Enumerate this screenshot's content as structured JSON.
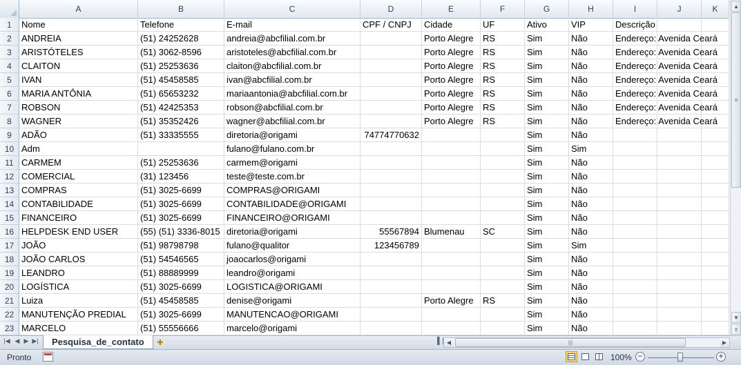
{
  "columns": [
    "A",
    "B",
    "C",
    "D",
    "E",
    "F",
    "G",
    "H",
    "I",
    "J",
    "K"
  ],
  "rows": [
    {
      "n": "1",
      "cells": [
        "Nome",
        "Telefone",
        "E-mail",
        "CPF / CNPJ",
        "Cidade",
        "UF",
        "Ativo",
        "VIP",
        "Descrição",
        "",
        ""
      ]
    },
    {
      "n": "2",
      "cells": [
        "ANDREIA",
        "(51) 24252628",
        "andreia@abcfilial.com.br",
        "",
        "Porto Alegre",
        "RS",
        "Sim",
        "Não",
        "Endereço: Avenida Ceará",
        "",
        ""
      ]
    },
    {
      "n": "3",
      "cells": [
        "ARISTÓTELES",
        "(51) 3062-8596",
        "aristoteles@abcfilial.com.br",
        "",
        "Porto Alegre",
        "RS",
        "Sim",
        "Não",
        "Endereço: Avenida Ceará",
        "",
        ""
      ]
    },
    {
      "n": "4",
      "cells": [
        "CLAITON",
        "(51) 25253636",
        "claiton@abcfilial.com.br",
        "",
        "Porto Alegre",
        "RS",
        "Sim",
        "Não",
        "Endereço: Avenida Ceará",
        "",
        ""
      ]
    },
    {
      "n": "5",
      "cells": [
        "IVAN",
        "(51) 45458585",
        "ivan@abcfilial.com.br",
        "",
        "Porto Alegre",
        "RS",
        "Sim",
        "Não",
        "Endereço: Avenida Ceará",
        "",
        ""
      ]
    },
    {
      "n": "6",
      "cells": [
        "MARIA ANTÔNIA",
        "(51) 65653232",
        "mariaantonia@abcfilial.com.br",
        "",
        "Porto Alegre",
        "RS",
        "Sim",
        "Não",
        "Endereço: Avenida Ceará",
        "",
        ""
      ]
    },
    {
      "n": "7",
      "cells": [
        "ROBSON",
        "(51) 42425353",
        "robson@abcfilial.com.br",
        "",
        "Porto Alegre",
        "RS",
        "Sim",
        "Não",
        "Endereço: Avenida Ceará",
        "",
        ""
      ]
    },
    {
      "n": "8",
      "cells": [
        "WAGNER",
        "(51) 35352426",
        "wagner@abcfilial.com.br",
        "",
        "Porto Alegre",
        "RS",
        "Sim",
        "Não",
        "Endereço: Avenida Ceará",
        "",
        ""
      ]
    },
    {
      "n": "9",
      "cells": [
        "ADÃO",
        "(51) 33335555",
        "diretoria@origami",
        "74774770632",
        "",
        "",
        "Sim",
        "Não",
        "",
        "",
        ""
      ]
    },
    {
      "n": "10",
      "cells": [
        "Adm",
        "",
        "fulano@fulano.com.br",
        "",
        "",
        "",
        "Sim",
        "Sim",
        "",
        "",
        ""
      ]
    },
    {
      "n": "11",
      "cells": [
        "CARMEM",
        "(51) 25253636",
        "carmem@origami",
        "",
        "",
        "",
        "Sim",
        "Não",
        "",
        "",
        ""
      ]
    },
    {
      "n": "12",
      "cells": [
        "COMERCIAL",
        "(31) 123456",
        "teste@teste.com.br",
        "",
        "",
        "",
        "Sim",
        "Não",
        "",
        "",
        ""
      ]
    },
    {
      "n": "13",
      "cells": [
        "COMPRAS",
        "(51) 3025-6699",
        "COMPRAS@ORIGAMI",
        "",
        "",
        "",
        "Sim",
        "Não",
        "",
        "",
        ""
      ]
    },
    {
      "n": "14",
      "cells": [
        "CONTABILIDADE",
        "(51) 3025-6699",
        "CONTABILIDADE@ORIGAMI",
        "",
        "",
        "",
        "Sim",
        "Não",
        "",
        "",
        ""
      ]
    },
    {
      "n": "15",
      "cells": [
        "FINANCEIRO",
        "(51) 3025-6699",
        "FINANCEIRO@ORIGAMI",
        "",
        "",
        "",
        "Sim",
        "Não",
        "",
        "",
        ""
      ]
    },
    {
      "n": "16",
      "cells": [
        "HELPDESK END USER",
        "(55) (51) 3336-8015",
        "diretoria@origami",
        "55567894",
        "Blumenau",
        "SC",
        "Sim",
        "Não",
        "",
        "",
        ""
      ]
    },
    {
      "n": "17",
      "cells": [
        "JOÃO",
        "(51) 98798798",
        "fulano@qualitor",
        "123456789",
        "",
        "",
        "Sim",
        "Sim",
        "",
        "",
        ""
      ]
    },
    {
      "n": "18",
      "cells": [
        "JOÃO CARLOS",
        "(51) 54546565",
        "joaocarlos@origami",
        "",
        "",
        "",
        "Sim",
        "Não",
        "",
        "",
        ""
      ]
    },
    {
      "n": "19",
      "cells": [
        "LEANDRO",
        "(51) 88889999",
        "leandro@origami",
        "",
        "",
        "",
        "Sim",
        "Não",
        "",
        "",
        ""
      ]
    },
    {
      "n": "20",
      "cells": [
        "LOGÍSTICA",
        "(51) 3025-6699",
        "LOGISTICA@ORIGAMI",
        "",
        "",
        "",
        "Sim",
        "Não",
        "",
        "",
        ""
      ]
    },
    {
      "n": "21",
      "cells": [
        "Luiza",
        "(51) 45458585",
        "denise@origami",
        "",
        "Porto Alegre",
        "RS",
        "Sim",
        "Não",
        "",
        "",
        ""
      ]
    },
    {
      "n": "22",
      "cells": [
        "MANUTENÇÃO PREDIAL",
        "(51) 3025-6699",
        "MANUTENCAO@ORIGAMI",
        "",
        "",
        "",
        "Sim",
        "Não",
        "",
        "",
        ""
      ]
    },
    {
      "n": "23",
      "cells": [
        "MARCELO",
        "(51) 55556666",
        "marcelo@origami",
        "",
        "",
        "",
        "Sim",
        "Não",
        "",
        "",
        ""
      ]
    }
  ],
  "sheet_tab": "Pesquisa_de_contato",
  "status": "Pronto",
  "zoom": "100%",
  "icons": {
    "nav_first": "first-sheet-icon",
    "nav_prev": "prev-sheet-icon",
    "nav_next": "next-sheet-icon",
    "nav_last": "last-sheet-icon",
    "new_sheet": "insert-sheet-icon",
    "macro": "macro-record-icon"
  }
}
